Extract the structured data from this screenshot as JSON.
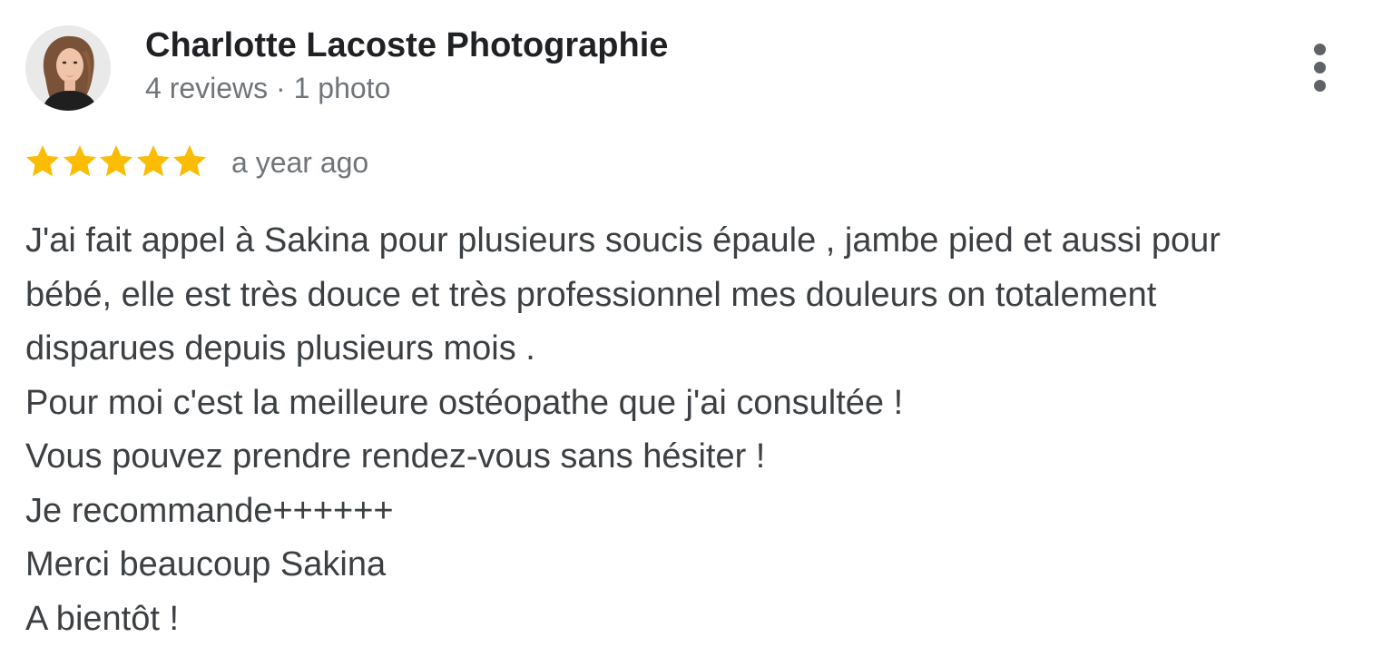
{
  "reviewer": {
    "name": "Charlotte Lacoste Photographie",
    "meta": "4 reviews · 1 photo",
    "avatar_icon": "profile-photo-avatar"
  },
  "menu": {
    "icon": "more-vertical-icon"
  },
  "review": {
    "rating": 5,
    "max_rating": 5,
    "star_color": "#fbbc04",
    "date": "a year ago",
    "lines": [
      "J'ai fait appel à Sakina pour plusieurs soucis épaule , jambe pied et aussi pour",
      "bébé, elle est très douce et très professionnel mes douleurs on totalement",
      "disparues depuis plusieurs mois .",
      "Pour moi c'est la meilleure ostéopathe que j'ai consultée !",
      "Vous pouvez prendre rendez-vous sans hésiter !",
      "Je recommande++++++",
      "Merci beaucoup Sakina",
      "A bientôt !"
    ]
  }
}
